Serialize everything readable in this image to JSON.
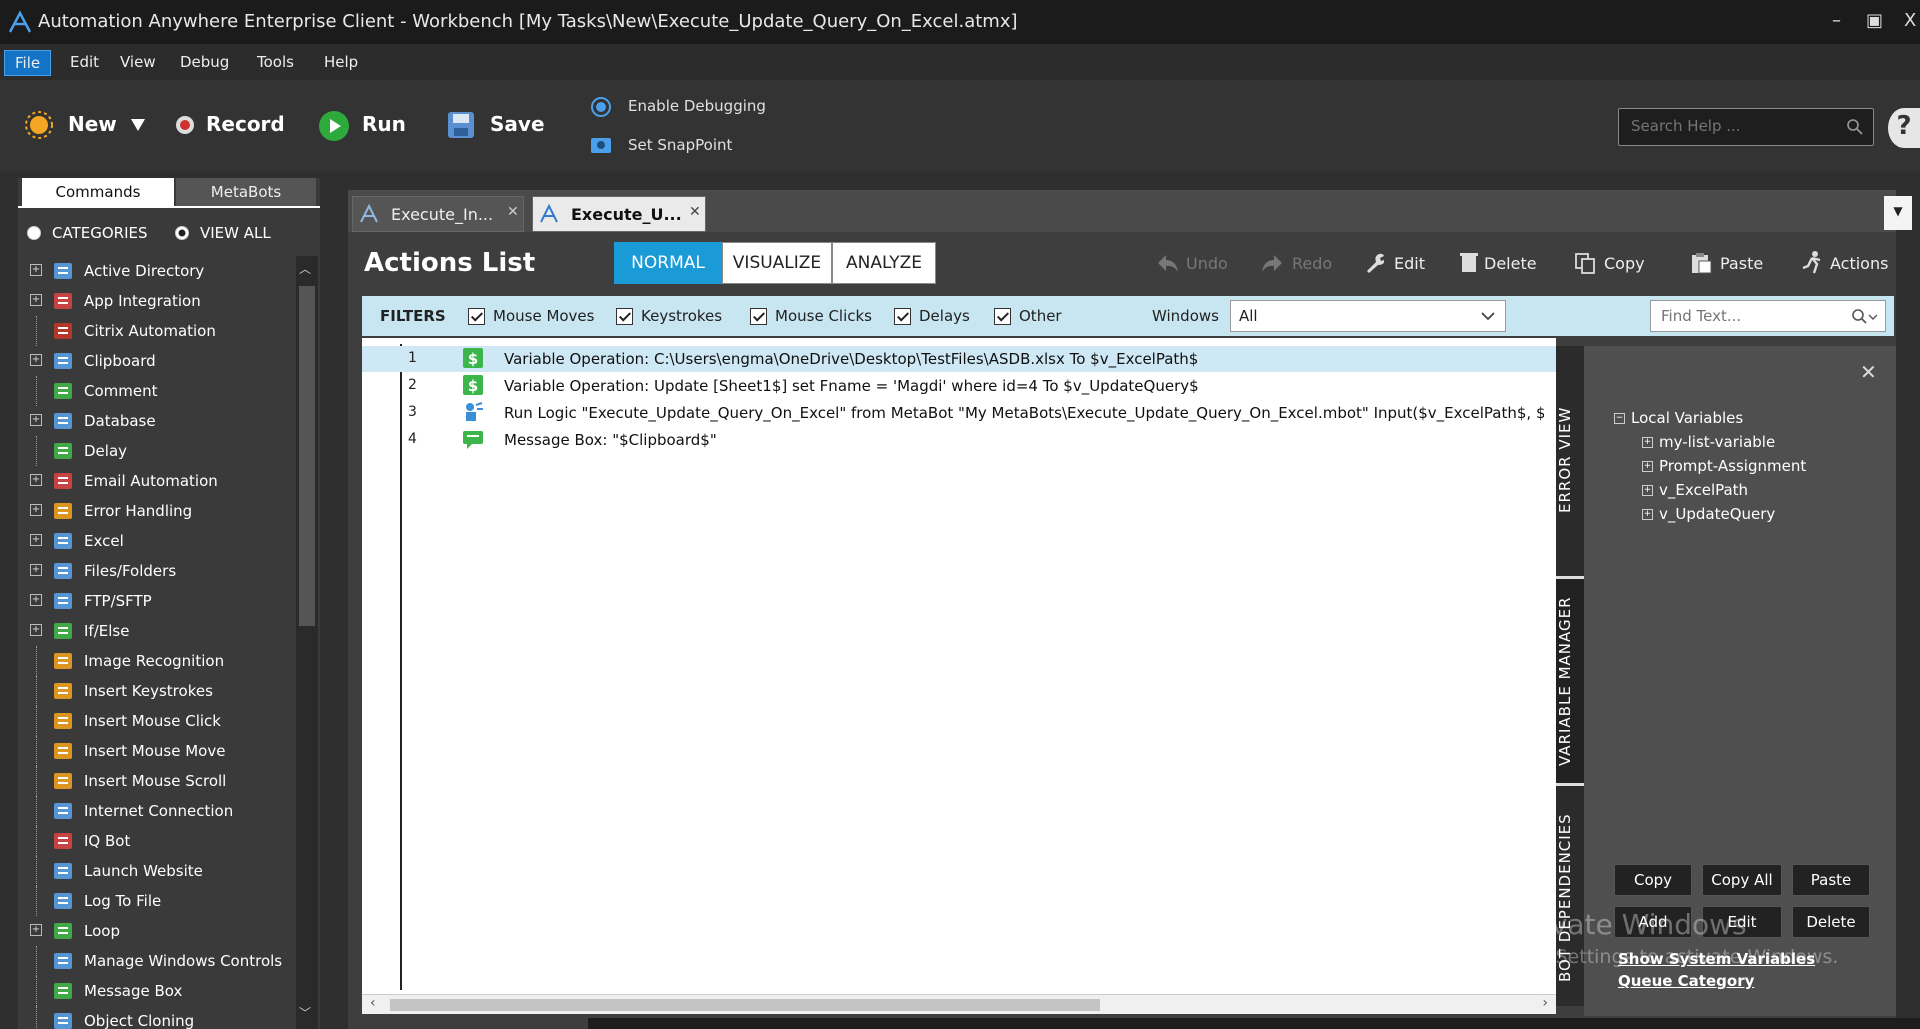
{
  "window": {
    "title": "Automation Anywhere Enterprise Client - Workbench [My Tasks\\New\\Execute_Update_Query_On_Excel.atmx]",
    "minimize": "–",
    "maximize": "▣",
    "close": "X"
  },
  "menu": [
    "File",
    "Edit",
    "View",
    "Debug",
    "Tools",
    "Help"
  ],
  "toolbar": {
    "new_label": "New",
    "record_label": "Record",
    "run_label": "Run",
    "save_label": "Save",
    "enable_debugging": "Enable Debugging",
    "set_snappoint": "Set SnapPoint",
    "search_placeholder": "Search Help ...",
    "help": "?"
  },
  "left_panel": {
    "tabs": [
      "Commands",
      "MetaBots"
    ],
    "filter_categories": "CATEGORIES",
    "filter_view_all": "VIEW ALL",
    "commands": [
      {
        "label": "Active Directory",
        "expandable": true,
        "icon": "active-directory-icon",
        "color": "#5aa0e6"
      },
      {
        "label": "App Integration",
        "expandable": true,
        "icon": "app-integration-icon",
        "color": "#d64545"
      },
      {
        "label": "Citrix Automation",
        "expandable": false,
        "icon": "citrix-icon",
        "color": "#c0392b"
      },
      {
        "label": "Clipboard",
        "expandable": true,
        "icon": "clipboard-icon",
        "color": "#5aa0e6"
      },
      {
        "label": "Comment",
        "expandable": false,
        "icon": "comment-icon",
        "color": "#43b549"
      },
      {
        "label": "Database",
        "expandable": true,
        "icon": "database-icon",
        "color": "#5aa0e6"
      },
      {
        "label": "Delay",
        "expandable": false,
        "icon": "delay-icon",
        "color": "#43b549"
      },
      {
        "label": "Email Automation",
        "expandable": true,
        "icon": "email-icon",
        "color": "#d64545"
      },
      {
        "label": "Error Handling",
        "expandable": true,
        "icon": "warning-icon",
        "color": "#f0a020"
      },
      {
        "label": "Excel",
        "expandable": true,
        "icon": "excel-icon",
        "color": "#5aa0e6"
      },
      {
        "label": "Files/Folders",
        "expandable": true,
        "icon": "folder-icon",
        "color": "#5aa0e6"
      },
      {
        "label": "FTP/SFTP",
        "expandable": true,
        "icon": "ftp-icon",
        "color": "#5aa0e6"
      },
      {
        "label": "If/Else",
        "expandable": true,
        "icon": "if-else-icon",
        "color": "#43b549"
      },
      {
        "label": "Image Recognition",
        "expandable": false,
        "icon": "image-recognition-icon",
        "color": "#f0a020"
      },
      {
        "label": "Insert Keystrokes",
        "expandable": false,
        "icon": "keystrokes-icon",
        "color": "#f0a020"
      },
      {
        "label": "Insert Mouse Click",
        "expandable": false,
        "icon": "mouse-click-icon",
        "color": "#f0a020"
      },
      {
        "label": "Insert Mouse Move",
        "expandable": false,
        "icon": "mouse-move-icon",
        "color": "#f0a020"
      },
      {
        "label": "Insert Mouse Scroll",
        "expandable": false,
        "icon": "mouse-scroll-icon",
        "color": "#f0a020"
      },
      {
        "label": "Internet Connection",
        "expandable": false,
        "icon": "globe-icon",
        "color": "#5aa0e6"
      },
      {
        "label": "IQ Bot",
        "expandable": false,
        "icon": "iq-bot-icon",
        "color": "#d64545"
      },
      {
        "label": "Launch Website",
        "expandable": false,
        "icon": "launch-website-icon",
        "color": "#5aa0e6"
      },
      {
        "label": "Log To File",
        "expandable": false,
        "icon": "log-file-icon",
        "color": "#5aa0e6"
      },
      {
        "label": "Loop",
        "expandable": true,
        "icon": "loop-icon",
        "color": "#43b549"
      },
      {
        "label": "Manage Windows Controls",
        "expandable": false,
        "icon": "windows-controls-icon",
        "color": "#5aa0e6"
      },
      {
        "label": "Message Box",
        "expandable": false,
        "icon": "message-box-icon",
        "color": "#43b549"
      },
      {
        "label": "Object Cloning",
        "expandable": false,
        "icon": "object-cloning-icon",
        "color": "#5aa0e6"
      }
    ]
  },
  "doc_tabs": [
    {
      "label": "Execute_In...",
      "active": false
    },
    {
      "label": "Execute_U...",
      "active": true
    }
  ],
  "actions_list": {
    "title": "Actions List",
    "view_modes": [
      "NORMAL",
      "VISUALIZE",
      "ANALYZE"
    ],
    "active_mode": "NORMAL",
    "actions": {
      "undo": "Undo",
      "redo": "Redo",
      "edit": "Edit",
      "delete": "Delete",
      "copy": "Copy",
      "paste": "Paste",
      "actions": "Actions"
    }
  },
  "filters": {
    "label": "FILTERS",
    "items": [
      "Mouse Moves",
      "Keystrokes",
      "Mouse Clicks",
      "Delays",
      "Other"
    ],
    "windows_label": "Windows",
    "windows_value": "All",
    "find_placeholder": "Find Text..."
  },
  "script_lines": [
    {
      "num": "1",
      "icon": "variable-operation-icon",
      "text": "Variable Operation: C:\\Users\\engma\\OneDrive\\Desktop\\TestFiles\\ASDB.xlsx To $v_ExcelPath$",
      "selected": true
    },
    {
      "num": "2",
      "icon": "variable-operation-icon",
      "text": "Variable Operation: Update [Sheet1$] set Fname = 'Magdi' where id=4 To $v_UpdateQuery$",
      "selected": false
    },
    {
      "num": "3",
      "icon": "run-logic-icon",
      "text": "Run Logic \"Execute_Update_Query_On_Excel\" from MetaBot \"My MetaBots\\Execute_Update_Query_On_Excel.mbot\" Input($v_ExcelPath$, $v_U",
      "selected": false
    },
    {
      "num": "4",
      "icon": "message-box-icon",
      "text": "Message Box: \"$Clipboard$\"",
      "selected": false
    }
  ],
  "side_tabs": [
    "ERROR VIEW",
    "VARIABLE MANAGER",
    "BOT DEPENDENCIES"
  ],
  "variable_manager": {
    "root": "Local Variables",
    "variables": [
      "my-list-variable",
      "Prompt-Assignment",
      "v_ExcelPath",
      "v_UpdateQuery"
    ],
    "close": "✕",
    "buttons_row1": [
      "Copy",
      "Copy All",
      "Paste"
    ],
    "buttons_row2": [
      "Add",
      "Edit",
      "Delete"
    ],
    "show_system_variables": "Show System Variables",
    "queue_category": "Queue Category"
  },
  "watermark": {
    "line1": "Activate Windows",
    "line2": "Go to Settings to activate Windows."
  }
}
